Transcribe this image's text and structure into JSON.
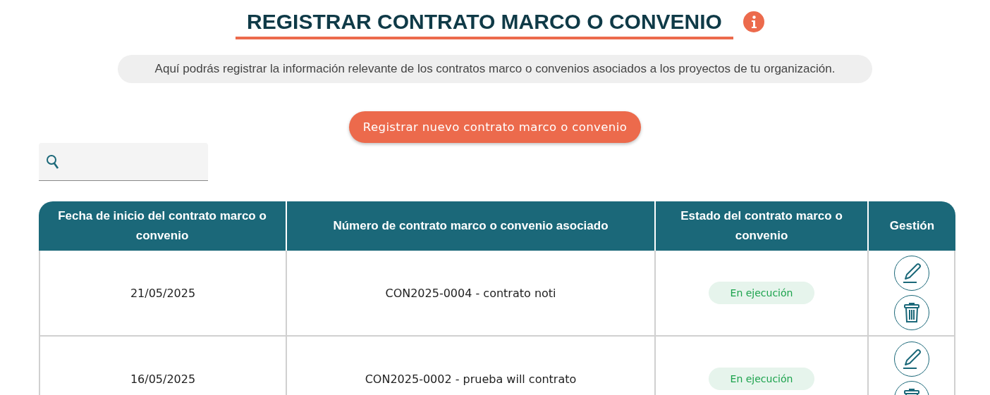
{
  "title": "REGISTRAR CONTRATO MARCO O CONVENIO",
  "description": "Aquí podrás registrar la información relevante de los contratos marco o convenios asociados a los proyectos de tu organización.",
  "new_button": "Registrar nuevo contrato marco o convenio",
  "table": {
    "columns": [
      "Fecha de inicio del contrato marco o convenio",
      "Número de contrato marco o convenio asociado",
      "Estado del contrato marco o convenio",
      "Gestión"
    ],
    "rows": [
      {
        "start_date": "21/05/2025",
        "contract": "CON2025-0004 - contrato noti",
        "status": {
          "label": "En ejecución",
          "kind": "active"
        }
      },
      {
        "start_date": "16/05/2025",
        "contract": "CON2025-0002 - prueba will contrato",
        "status": {
          "label": "En ejecución",
          "kind": "active"
        }
      }
    ]
  }
}
